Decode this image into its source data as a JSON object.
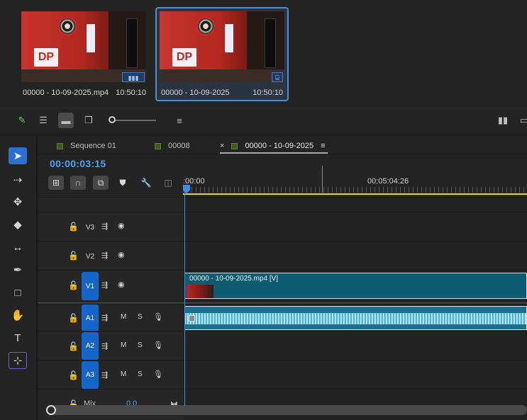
{
  "project": {
    "clips": [
      {
        "name": "00000 - 10-09-2025.mp4",
        "duration": "10:50:10",
        "badge": "▮▮▮ ▸▸▸",
        "selected": false,
        "logo": "DP"
      },
      {
        "name": "00000 - 10-09-2025",
        "duration": "10:50:10",
        "badge": "⌸",
        "selected": true,
        "logo": "DP"
      }
    ]
  },
  "timeline": {
    "tabs": [
      {
        "label": "Sequence 01",
        "active": false
      },
      {
        "label": "00008",
        "active": false
      },
      {
        "label": "00000 - 10-09-2025",
        "active": true
      }
    ],
    "close_glyph": "×",
    "menu_glyph": "≡",
    "timecode": "00:00:03:15",
    "ruler": {
      "start_label": ":00:00",
      "mid_label": "00:05:04:26"
    },
    "tracks": [
      {
        "name": "V3",
        "kind": "video",
        "targeted": false
      },
      {
        "name": "V2",
        "kind": "video",
        "targeted": false
      },
      {
        "name": "V1",
        "kind": "video",
        "targeted": true
      },
      {
        "name": "A1",
        "kind": "audio",
        "targeted": true,
        "m": "M",
        "s": "S"
      },
      {
        "name": "A2",
        "kind": "audio",
        "targeted": true,
        "m": "M",
        "s": "S"
      },
      {
        "name": "A3",
        "kind": "audio",
        "targeted": true,
        "m": "M",
        "s": "S"
      }
    ],
    "v1_clip_label": "00000 - 10-09-2025.mp4 [V]",
    "mix": {
      "label": "Mix",
      "value": "0.0"
    }
  },
  "colors": {
    "accent_blue": "#3b8ef0",
    "timecode_blue": "#4fa3f7",
    "video_clip": "#0e5b72",
    "audio_clip": "#1a6f8c",
    "work_area": "#e2d23a",
    "target_track": "#1565c8"
  }
}
